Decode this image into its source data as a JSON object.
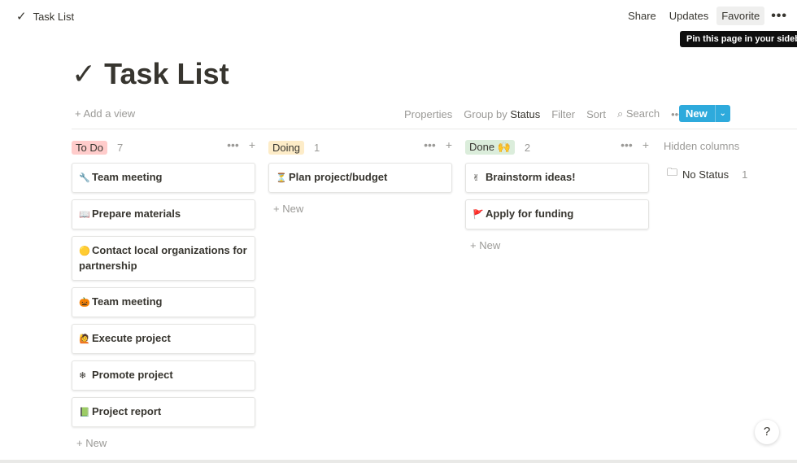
{
  "header": {
    "breadcrumb_icon": "checkmark-icon",
    "breadcrumb_label": "Task List",
    "actions": {
      "share": "Share",
      "updates": "Updates",
      "favorite": "Favorite",
      "more": "•••"
    },
    "tooltip": "Pin this page in your sidebar"
  },
  "page": {
    "title_icon": "✓",
    "title": "Task List"
  },
  "viewbar": {
    "add_view": "+ Add a view",
    "properties": "Properties",
    "group_by": "Group by",
    "group_value": "Status",
    "filter": "Filter",
    "sort": "Sort",
    "search": "Search",
    "more": "•••",
    "new": "New"
  },
  "columns": [
    {
      "tag": "To Do",
      "count": "7",
      "color": "#ffcccb",
      "cards": [
        {
          "icon": "🔧",
          "label": "Team meeting"
        },
        {
          "icon": "📖",
          "label": "Prepare materials"
        },
        {
          "icon": "🟡",
          "label": "Contact local organizations for partnership"
        },
        {
          "icon": "🎃",
          "label": "Team meeting"
        },
        {
          "icon": "🙋",
          "label": "Execute project"
        },
        {
          "icon": "❄",
          "label": "Promote project"
        },
        {
          "icon": "📗",
          "label": "Project report"
        }
      ],
      "new_label": "+ New"
    },
    {
      "tag": "Doing",
      "count": "1",
      "color": "#fdecc8",
      "cards": [
        {
          "icon": "⏳",
          "label": "Plan project/budget"
        }
      ],
      "new_label": "+ New"
    },
    {
      "tag": "Done 🙌",
      "count": "2",
      "color": "#dbeddb",
      "cards": [
        {
          "icon": "✌",
          "label": "Brainstorm ideas!"
        },
        {
          "icon": "🚩",
          "label": "Apply for funding"
        }
      ],
      "new_label": "+ New"
    }
  ],
  "hidden": {
    "label": "Hidden columns",
    "no_status": "No Status",
    "no_status_count": "1"
  },
  "help": "?"
}
